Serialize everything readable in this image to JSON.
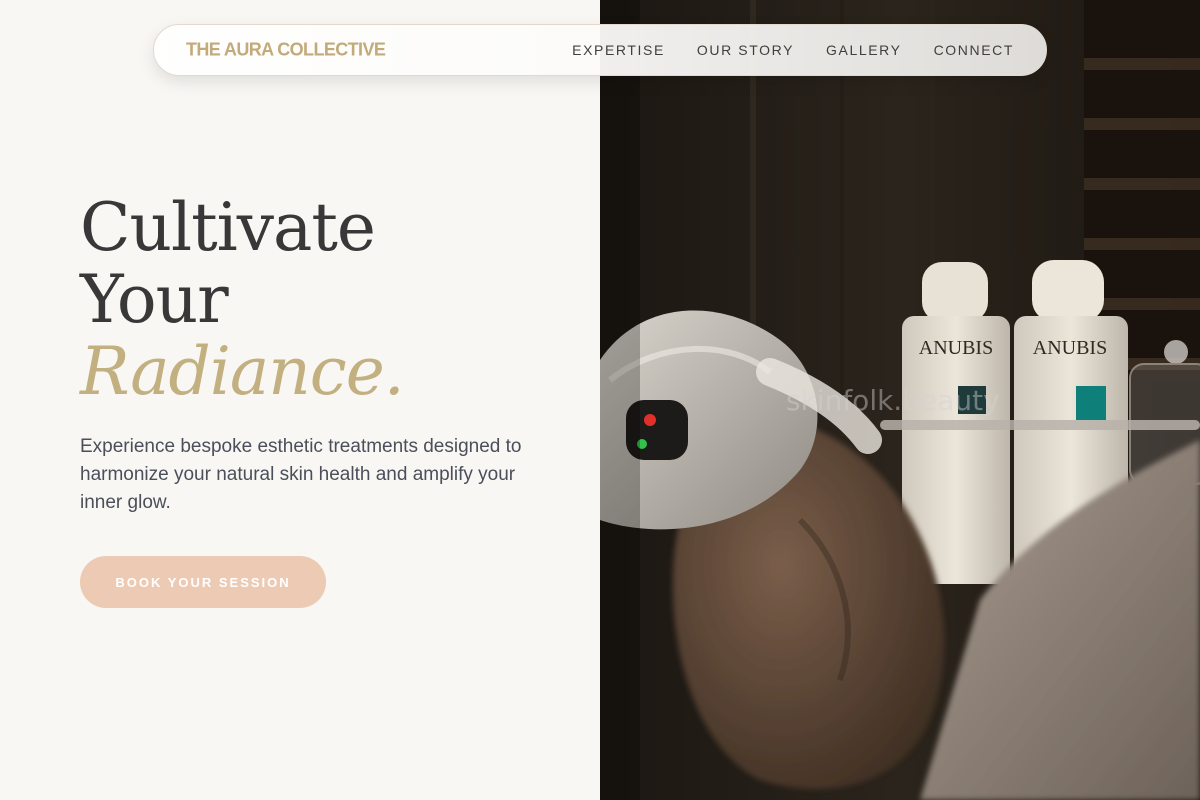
{
  "brand": {
    "name": "THE AURA COLLECTIVE"
  },
  "nav": {
    "links": [
      {
        "label": "EXPERTISE"
      },
      {
        "label": "OUR STORY"
      },
      {
        "label": "GALLERY"
      },
      {
        "label": "CONNECT"
      }
    ]
  },
  "hero": {
    "headline_line1": "Cultivate",
    "headline_line2": "Your",
    "headline_accent": "Radiance.",
    "subtext": "Experience bespoke esthetic treatments designed to harmonize your natural skin health and amplify your inner glow.",
    "cta_label": "BOOK YOUR SESSION"
  },
  "photo": {
    "bottle_label_1": "ANUBIS",
    "bottle_label_2": "ANUBIS",
    "watermark": "skinfolk.beauty"
  },
  "colors": {
    "background": "#f9f7f4",
    "brand_gold": "#c2aa7a",
    "accent_gold": "#c2b080",
    "headline": "#383838",
    "body_text": "#4b4f5a",
    "cta_background": "#edcab3",
    "cta_text": "#ffffff"
  }
}
